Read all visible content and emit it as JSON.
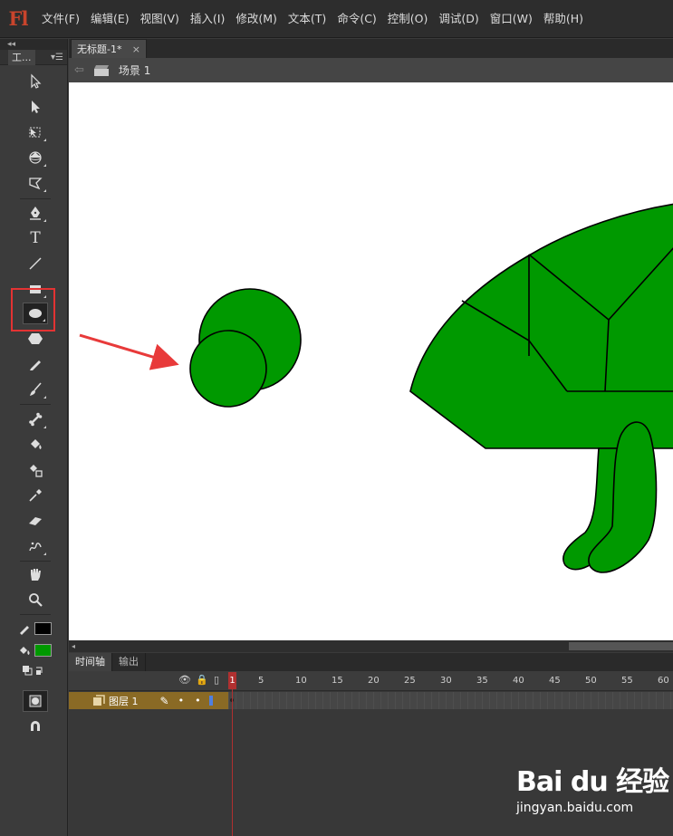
{
  "app": {
    "logo_text": "Fl",
    "menu": [
      "文件(F)",
      "编辑(E)",
      "视图(V)",
      "插入(I)",
      "修改(M)",
      "文本(T)",
      "命令(C)",
      "控制(O)",
      "调试(D)",
      "窗口(W)",
      "帮助(H)"
    ]
  },
  "tools_panel": {
    "tab_label": "工...",
    "collapse_glyph": "◂◂",
    "menu_glyph": "▾☰",
    "tools": [
      {
        "name": "selection-tool",
        "icon": "arrow"
      },
      {
        "name": "subselection-tool",
        "icon": "arrow-hollow"
      },
      {
        "name": "free-transform-tool",
        "icon": "transform"
      },
      {
        "name": "3d-rotation-tool",
        "icon": "3d-rotate"
      },
      {
        "name": "lasso-tool",
        "icon": "lasso"
      },
      {
        "name": "pen-tool",
        "icon": "pen"
      },
      {
        "name": "text-tool",
        "icon": "text",
        "glyph": "T"
      },
      {
        "name": "line-tool",
        "icon": "line"
      },
      {
        "name": "rectangle-tool",
        "icon": "rectangle"
      },
      {
        "name": "oval-tool",
        "icon": "oval"
      },
      {
        "name": "polystar-tool",
        "icon": "hexagon"
      },
      {
        "name": "pencil-tool",
        "icon": "pencil"
      },
      {
        "name": "brush-tool",
        "icon": "brush"
      },
      {
        "name": "bone-tool",
        "icon": "bone"
      },
      {
        "name": "paint-bucket-tool",
        "icon": "bucket"
      },
      {
        "name": "ink-bottle-tool",
        "icon": "ink-bottle"
      },
      {
        "name": "eyedropper-tool",
        "icon": "eyedropper"
      },
      {
        "name": "eraser-tool",
        "icon": "eraser"
      },
      {
        "name": "deco-tool",
        "icon": "deco"
      },
      {
        "name": "hand-tool",
        "icon": "hand"
      },
      {
        "name": "zoom-tool",
        "icon": "magnifier"
      }
    ],
    "stroke_color": "#000000",
    "fill_color": "#009900",
    "highlight_color": "#e33333"
  },
  "document": {
    "tab_title": "无标题-1*",
    "close_glyph": "×",
    "scene_label": "场景 1",
    "back_glyph": "⇦"
  },
  "stage": {
    "background": "#ffffff",
    "shape_fill": "#009900",
    "shape_stroke": "#000000",
    "arrow_color": "#e83a3a"
  },
  "timeline": {
    "tabs": [
      "时间轴",
      "输出"
    ],
    "layer_name": "图层 1",
    "frame_numbers": [
      "1",
      "5",
      "10",
      "15",
      "20",
      "25",
      "30",
      "35",
      "40",
      "45",
      "50",
      "55",
      "60"
    ],
    "current_frame": "1",
    "icons": {
      "eye": "👁",
      "lock": "🔒",
      "outline": "▯",
      "pencil": "✎",
      "dot": "•"
    }
  },
  "watermark": {
    "logo": "Bai du 经验",
    "url": "jingyan.baidu.com"
  }
}
